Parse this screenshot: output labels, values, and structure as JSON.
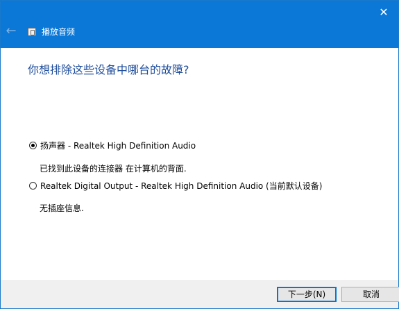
{
  "window": {
    "title": "播放音频",
    "close_glyph": "✕",
    "back_glyph": "←"
  },
  "content": {
    "question": "你想排除这些设备中哪台的故障?",
    "options": [
      {
        "label": "扬声器 - Realtek High Definition Audio",
        "description": "已找到此设备的连接器 在计算机的背面.",
        "selected": true
      },
      {
        "label": "Realtek Digital Output - Realtek High Definition Audio (当前默认设备)",
        "description": "无插座信息.",
        "selected": false
      }
    ]
  },
  "footer": {
    "next_label": "下一步(N)",
    "cancel_label": "取消"
  },
  "colors": {
    "titlebar": "#0b78d7",
    "question_text": "#1f4e9c",
    "footer_bg": "#f0f0f0"
  }
}
